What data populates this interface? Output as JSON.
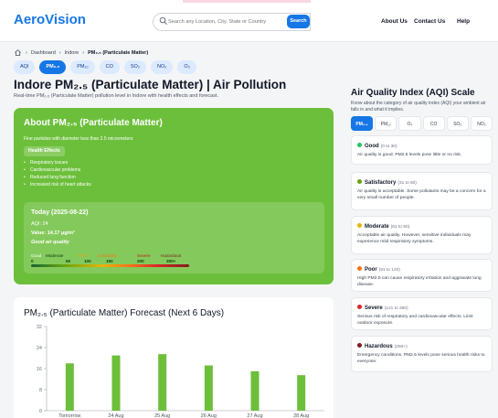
{
  "header": {
    "logo": "AeroVision",
    "search_placeholder": "Search any Location, City, State or Country",
    "search_button": "Search",
    "nav": [
      "About Us",
      "Contact Us",
      "Help"
    ]
  },
  "breadcrumb": [
    "Dashboard",
    "Indore",
    "PM₂.₅ (Particulate Matter)"
  ],
  "pollutant_tabs": [
    "AQI",
    "PM₂.₅",
    "PM₁₀",
    "CO",
    "SO₂",
    "NO₂",
    "O₃"
  ],
  "page": {
    "title": "Indore PM₂.₅ (Particulate Matter) | Air Pollution",
    "subtitle": "Real-time PM₂.₅ (Particulate Matter) pollution level in Indore with health effects and forecast."
  },
  "about": {
    "heading": "About PM₂.₅ (Particulate Matter)",
    "description": "Fine particles with diameter less than 2.5 micrometers",
    "effects_label": "Health Effects",
    "effects": [
      "Respiratory issues",
      "Cardiovascular problems",
      "Reduced lung function",
      "Increased risk of heart attacks"
    ]
  },
  "today": {
    "title": "Today (2025-08-22)",
    "aqi": "AQI: 24",
    "value": "Value: 14.17 µg/m³",
    "category": "Good air quality",
    "scale_labels": [
      "Good",
      "Moderate",
      "Poor",
      "Unhealthy",
      "Severe",
      "Hazardous"
    ],
    "scale_numbers": [
      "0",
      "50",
      "100",
      "150",
      "200",
      "300+"
    ]
  },
  "forecast": {
    "heading": "PM₂.₅ (Particulate Matter) Forecast (Next 6 Days)"
  },
  "chart_data": {
    "type": "bar",
    "categories": [
      "Tomorrow",
      "24 Aug",
      "25 Aug",
      "26 Aug",
      "27 Aug",
      "28 Aug"
    ],
    "values": [
      18,
      21,
      21.5,
      17.2,
      15,
      13.5
    ],
    "yticks": [
      0,
      8,
      16,
      24,
      32
    ],
    "ylim": [
      0,
      32
    ],
    "color": "#6cbf3b"
  },
  "aqi_scale": {
    "title": "Air Quality Index (AQI) Scale",
    "description": "Know about the category of air quality index (AQI) your ambient air falls in and what it implies.",
    "tabs": [
      "PM₂.₅",
      "PM₁₀",
      "O₃",
      "CO",
      "SO₂",
      "NO₂"
    ],
    "levels": [
      {
        "name": "Good",
        "range": "(0 to 30)",
        "color": "#22c55e",
        "text": "Air quality is good. PM2.5 levels pose little or no risk."
      },
      {
        "name": "Satisfactory",
        "range": "(31 to 60)",
        "color": "#65a30d",
        "text": "Air quality is acceptable. Some pollutants may be a concern for a very small number of people."
      },
      {
        "name": "Moderate",
        "range": "(61 to 90)",
        "color": "#eab308",
        "text": "Acceptable air quality. However, sensitive individuals may experience mild respiratory symptoms."
      },
      {
        "name": "Poor",
        "range": "(91 to 120)",
        "color": "#f97316",
        "text": "High PM2.5 can cause respiratory irritation and aggravate lung disease."
      },
      {
        "name": "Severe",
        "range": "(121 to 250)",
        "color": "#dc2626",
        "text": "Serious risk of respiratory and cardiovascular effects. Limit outdoor exposure."
      },
      {
        "name": "Hazardous",
        "range": "(250+)",
        "color": "#7f1d1d",
        "text": "Emergency conditions. PM2.5 levels pose serious health risks to everyone."
      }
    ]
  }
}
